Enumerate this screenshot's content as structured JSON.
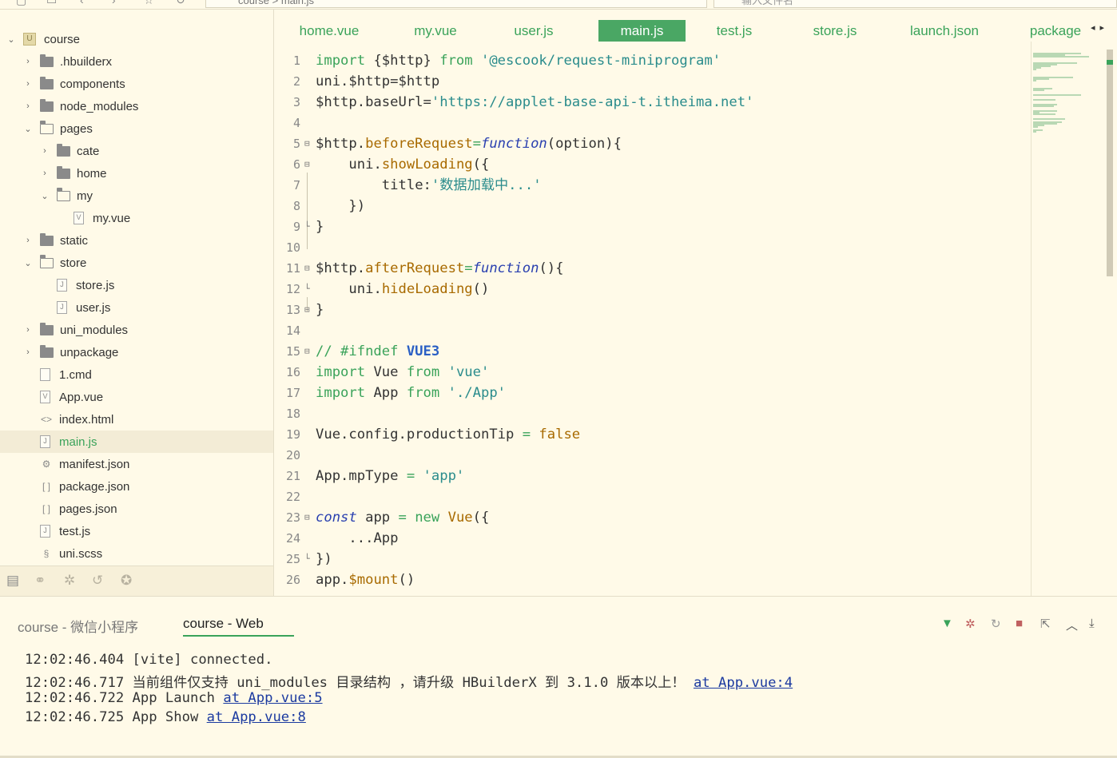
{
  "topbar": {
    "address": "course > main.js",
    "search_placeholder": "输入文件名"
  },
  "explorer": {
    "items": [
      {
        "label": "course",
        "type": "project",
        "expanded": true,
        "depth": 0
      },
      {
        "label": ".hbuilderx",
        "type": "folder",
        "depth": 1
      },
      {
        "label": "components",
        "type": "folder",
        "depth": 1
      },
      {
        "label": "node_modules",
        "type": "folder",
        "depth": 1
      },
      {
        "label": "pages",
        "type": "folder-open",
        "expanded": true,
        "depth": 1
      },
      {
        "label": "cate",
        "type": "folder",
        "depth": 2
      },
      {
        "label": "home",
        "type": "folder",
        "depth": 2
      },
      {
        "label": "my",
        "type": "folder-open",
        "expanded": true,
        "depth": 2
      },
      {
        "label": "my.vue",
        "type": "vue",
        "depth": 3
      },
      {
        "label": "static",
        "type": "folder",
        "depth": 1
      },
      {
        "label": "store",
        "type": "folder-open",
        "expanded": true,
        "depth": 1
      },
      {
        "label": "store.js",
        "type": "js",
        "depth": 2
      },
      {
        "label": "user.js",
        "type": "js",
        "depth": 2
      },
      {
        "label": "uni_modules",
        "type": "folder",
        "depth": 1
      },
      {
        "label": "unpackage",
        "type": "folder",
        "depth": 1
      },
      {
        "label": "1.cmd",
        "type": "file",
        "depth": 1
      },
      {
        "label": "App.vue",
        "type": "vue",
        "depth": 1
      },
      {
        "label": "index.html",
        "type": "html",
        "depth": 1
      },
      {
        "label": "main.js",
        "type": "js",
        "depth": 1,
        "active": true
      },
      {
        "label": "manifest.json",
        "type": "manifest",
        "depth": 1
      },
      {
        "label": "package.json",
        "type": "json",
        "depth": 1
      },
      {
        "label": "pages.json",
        "type": "json",
        "depth": 1
      },
      {
        "label": "test.js",
        "type": "js",
        "depth": 1
      },
      {
        "label": "uni.scss",
        "type": "scss",
        "depth": 1
      }
    ]
  },
  "tabs": [
    "home.vue",
    "my.vue",
    "user.js",
    "main.js",
    "test.js",
    "store.js",
    "launch.json",
    "package"
  ],
  "active_tab": "main.js",
  "code": {
    "lines": [
      "1",
      "2",
      "3",
      "4",
      "5",
      "6",
      "7",
      "8",
      "9",
      "10",
      "11",
      "12",
      "13",
      "14",
      "15",
      "16",
      "17",
      "18",
      "19",
      "20",
      "21",
      "22",
      "23",
      "24",
      "25",
      "26"
    ],
    "l1": [
      "import",
      " {$http} ",
      "from",
      " '@escook/request-miniprogram'"
    ],
    "l2": "uni.$http=$http",
    "l3": [
      "$http.baseUrl=",
      "'https://applet-base-api-t.itheima.net'"
    ],
    "l5": [
      "$http.",
      "beforeRequest",
      "=",
      "function",
      "(option){"
    ],
    "l6": [
      "uni.",
      "showLoading",
      "({"
    ],
    "l7": [
      "title:",
      "'数据加载中...'"
    ],
    "l8": "})",
    "l9": "}",
    "l11": [
      "$http.",
      "afterRequest",
      "=",
      "function",
      "(){"
    ],
    "l12": [
      "uni.",
      "hideLoading",
      "()"
    ],
    "l13": "}",
    "l15": [
      "// #ifndef ",
      "VUE3"
    ],
    "l16": [
      "import",
      " Vue ",
      "from",
      " 'vue'"
    ],
    "l17": [
      "import",
      " App ",
      "from",
      " './App'"
    ],
    "l19": [
      "Vue.config.productionTip ",
      "=",
      " false"
    ],
    "l21": [
      "App.mpType ",
      "=",
      " 'app'"
    ],
    "l23": [
      "const",
      " app ",
      "=",
      " new",
      " Vue",
      "({"
    ],
    "l24": "...App",
    "l25": "})",
    "l26": [
      "app.",
      "$mount",
      "()"
    ]
  },
  "console": {
    "tabs": [
      "course - 微信小程序",
      "course - Web"
    ],
    "active_tab": "course - Web",
    "lines": [
      {
        "time": "12:02:46.404",
        "text": " [vite] connected.",
        "link": ""
      },
      {
        "time": "12:02:46.717",
        "text": " 当前组件仅支持 uni_modules 目录结构 ，请升级 HBuilderX 到 3.1.0 版本以上！ ",
        "link": "at App.vue:4"
      },
      {
        "time": "12:02:46.722",
        "text": " App Launch ",
        "link": "at App.vue:5"
      },
      {
        "time": "12:02:46.725",
        "text": " App Show ",
        "link": "at App.vue:8"
      }
    ]
  },
  "colors": {
    "accent": "#4aa764",
    "background": "#fffae8",
    "link": "#1b3aa0"
  }
}
